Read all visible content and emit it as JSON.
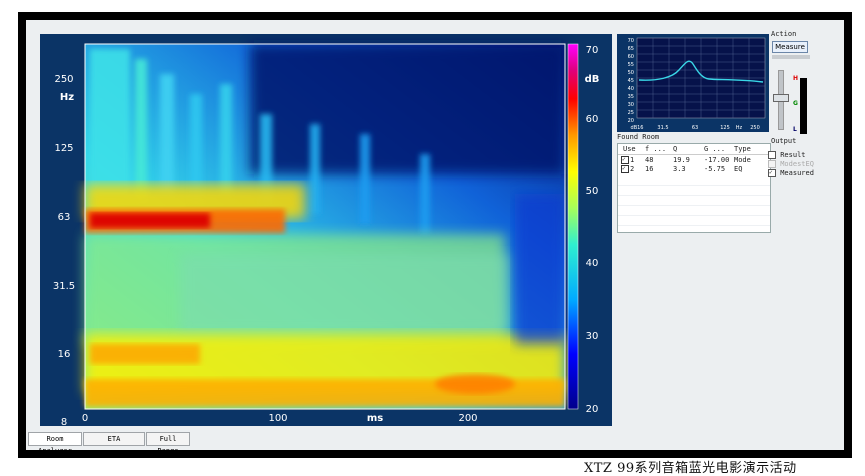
{
  "spectrogram": {
    "y_ticks": [
      "250",
      "125",
      "63",
      "31.5",
      "16",
      "8"
    ],
    "y_unit": "Hz",
    "x_ticks": [
      "0",
      "100",
      "200"
    ],
    "x_unit": "ms",
    "colorbar_ticks": [
      "70",
      "60",
      "50",
      "40",
      "30",
      "20"
    ],
    "colorbar_unit": "dB"
  },
  "mini_plot": {
    "y_ticks": [
      "70",
      "65",
      "60",
      "55",
      "50",
      "45",
      "40",
      "35",
      "30",
      "25",
      "20"
    ],
    "x_ticks": [
      "dB16",
      "31.5",
      "63",
      "125",
      "250"
    ],
    "x_unit": "Hz"
  },
  "found_room": {
    "title": "Found Room",
    "columns": [
      "Use",
      "f ...",
      "Q",
      "G ...",
      "Type"
    ],
    "rows": [
      {
        "use": "1",
        "f": "48",
        "q": "19.9",
        "g": "-17.00",
        "type": "Mode"
      },
      {
        "use": "2",
        "f": "16",
        "q": "3.3",
        "g": "-5.75",
        "type": "EQ"
      }
    ]
  },
  "action": {
    "label": "Action",
    "measure_button": "Measure",
    "output_label": "Output",
    "meter_labels": [
      "H",
      "G",
      "L"
    ]
  },
  "options": [
    {
      "label": "Result",
      "checked": false,
      "enabled": true
    },
    {
      "label": "ModestEQ",
      "checked": false,
      "enabled": false
    },
    {
      "label": "Measured",
      "checked": true,
      "enabled": true
    }
  ],
  "tabs": [
    "Room Analyzer",
    "ETA",
    "Full Range"
  ],
  "watermark": "XTZ  99系列音箱蓝光电影演示活动",
  "colors": {
    "panel_bg": "#0b3466",
    "cyan": "#39d6e6",
    "heat_red": "#cc0000"
  }
}
